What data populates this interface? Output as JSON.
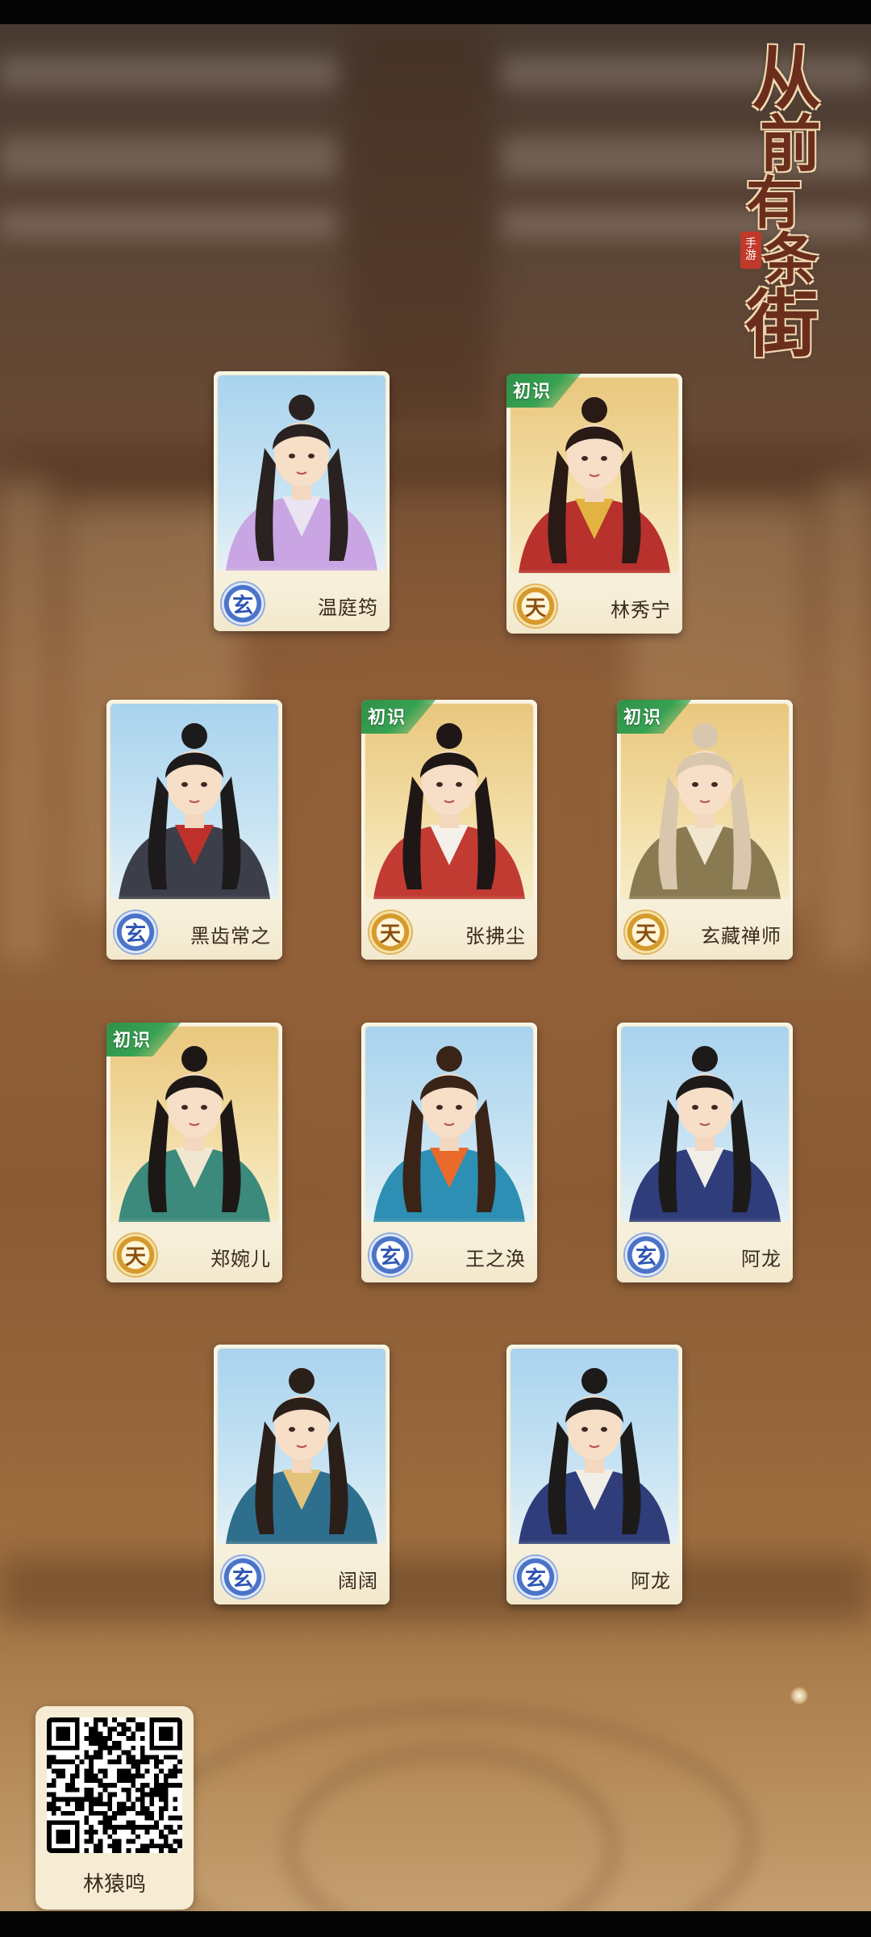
{
  "logo": {
    "title_chars": [
      "从",
      "前",
      "有",
      "条",
      "街"
    ],
    "seal_chars": [
      "手",
      "游"
    ]
  },
  "cards": [
    {
      "name": "温庭筠",
      "rarity": "玄",
      "new_tag": ""
    },
    {
      "name": "林秀宁",
      "rarity": "天",
      "new_tag": "初识"
    },
    {
      "name": "黑齿常之",
      "rarity": "玄",
      "new_tag": ""
    },
    {
      "name": "张拂尘",
      "rarity": "天",
      "new_tag": "初识"
    },
    {
      "name": "玄藏禅师",
      "rarity": "天",
      "new_tag": "初识"
    },
    {
      "name": "郑婉儿",
      "rarity": "天",
      "new_tag": "初识"
    },
    {
      "name": "王之涣",
      "rarity": "玄",
      "new_tag": ""
    },
    {
      "name": "阿龙",
      "rarity": "玄",
      "new_tag": ""
    },
    {
      "name": "阔阔",
      "rarity": "玄",
      "new_tag": ""
    },
    {
      "name": "阿龙",
      "rarity": "玄",
      "new_tag": ""
    }
  ],
  "qr": {
    "label": "林猿鸣"
  }
}
